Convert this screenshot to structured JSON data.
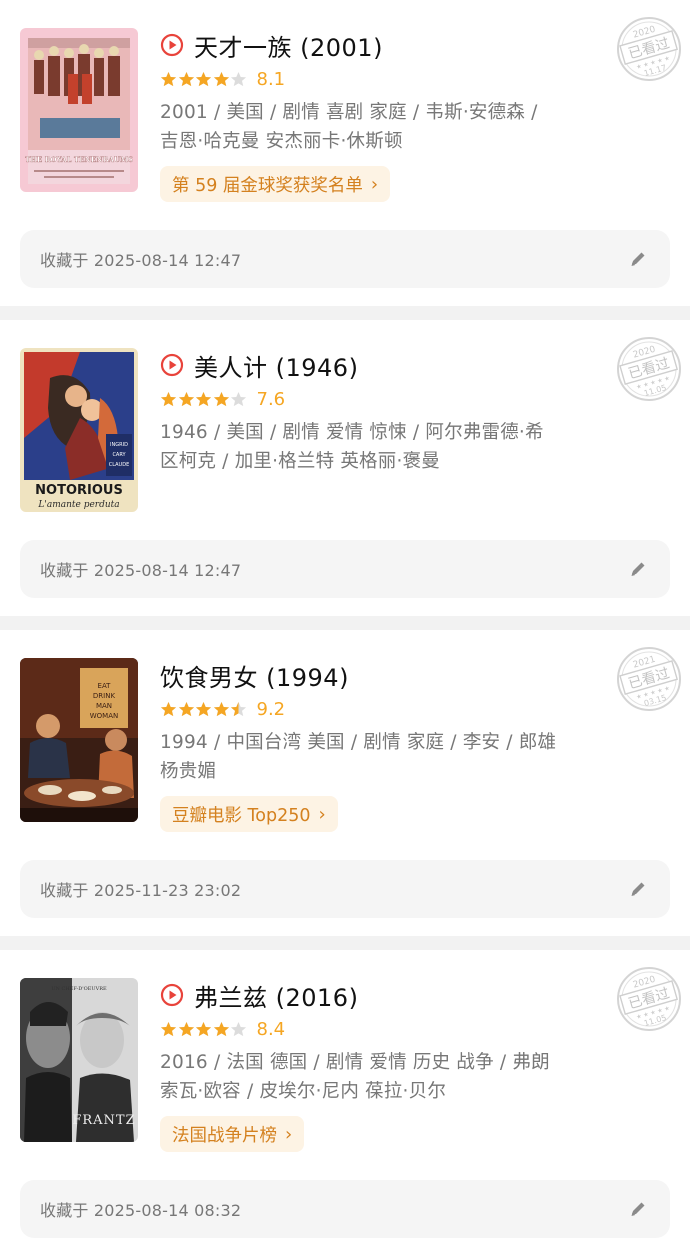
{
  "movies": [
    {
      "title": "天才一族 (2001)",
      "has_play": true,
      "stars": 4,
      "score": "8.1",
      "meta_line1": "2001 / 美国 / 剧情 喜剧 家庭 / 韦斯·安德森 /",
      "meta_line2": "吉恩·哈克曼 安杰丽卡·休斯顿",
      "tag": "第 59 届金球奖获奖名单",
      "stamp_year": "2020",
      "stamp_label": "已看过",
      "stamp_date": "11.17",
      "poster_text": "THE ROYAL TENENBAUMS",
      "note": "收藏于 2025-08-14 12:47"
    },
    {
      "title": "美人计 (1946)",
      "has_play": true,
      "stars": 4,
      "score": "7.6",
      "meta_line1": "1946 / 美国 / 剧情 爱情 惊悚 / 阿尔弗雷德·希",
      "meta_line2": "区柯克 / 加里·格兰特 英格丽·褒曼",
      "tag": "",
      "stamp_year": "2020",
      "stamp_label": "已看过",
      "stamp_date": "11.05",
      "poster_text": "NOTORIOUS",
      "poster_subtext": "L'amante perduta",
      "note": "收藏于 2025-08-14 12:47"
    },
    {
      "title": "饮食男女 (1994)",
      "has_play": false,
      "stars": 4.5,
      "score": "9.2",
      "meta_line1": "1994 / 中国台湾 美国 / 剧情 家庭 / 李安 / 郎雄",
      "meta_line2": "杨贵媚",
      "tag": "豆瓣电影 Top250",
      "stamp_year": "2021",
      "stamp_label": "已看过",
      "stamp_date": "03.15",
      "poster_text": "EAT DRINK MAN WOMAN",
      "note": "收藏于 2025-11-23 23:02"
    },
    {
      "title": "弗兰兹 (2016)",
      "has_play": true,
      "stars": 4,
      "score": "8.4",
      "meta_line1": "2016 / 法国 德国 / 剧情 爱情 历史 战争 / 弗朗",
      "meta_line2": "索瓦·欧容 / 皮埃尔·尼内 葆拉·贝尔",
      "tag": "法国战争片榜",
      "stamp_year": "2020",
      "stamp_label": "已看过",
      "stamp_date": "11.05",
      "poster_text": "FRANTZ",
      "note": "收藏于 2025-08-14 08:32"
    }
  ],
  "colors": {
    "star": "#f5a623",
    "play": "#e8433b",
    "tag_bg": "#fdf3e4",
    "tag_text": "#d4811f"
  },
  "icons": {
    "play": "play-circle-icon",
    "edit": "pencil-icon",
    "star": "star-icon",
    "stamp": "watched-stamp-icon"
  }
}
